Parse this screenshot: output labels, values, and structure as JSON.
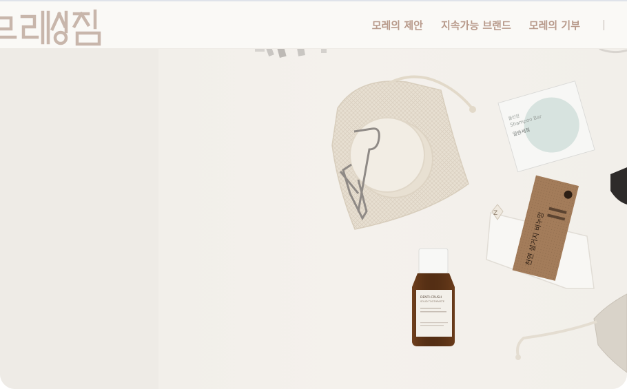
{
  "header": {
    "logo_text": "모레상점",
    "nav": [
      {
        "label": "모레의 제안"
      },
      {
        "label": "지속가능 브랜드"
      },
      {
        "label": "모레의 기부"
      }
    ]
  },
  "hero": {
    "products": {
      "shampoo_box": {
        "line1": "Shampoo Bar",
        "line2": "올인원",
        "line3": "일반세정"
      },
      "bottle": {
        "brand": "DENTI-CRUSH",
        "subtitle": "SOLID TOOTHPASTE"
      },
      "soap_pack": {
        "korean": "천연 설거지 비누망"
      }
    }
  },
  "colors": {
    "nav_text": "#b89a8b",
    "logo": "#c8b6ab",
    "hero_bg": "#f2efea",
    "header_bg": "#faf9f6"
  }
}
